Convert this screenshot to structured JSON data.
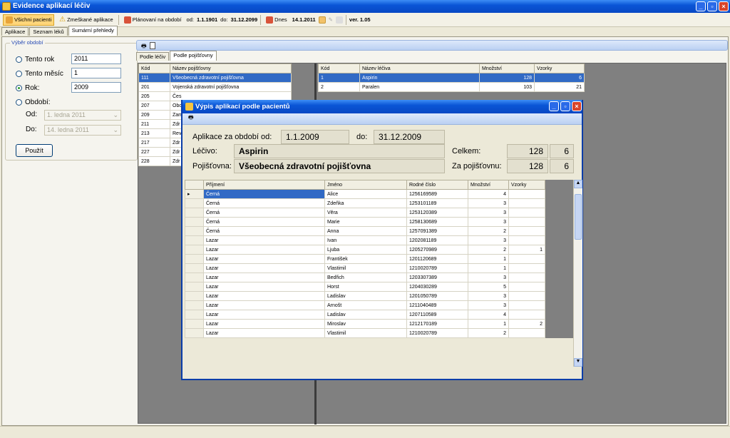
{
  "window": {
    "title": "Evidence aplikací léčiv"
  },
  "toolbar": {
    "btn_all": "Všichni pacienti",
    "btn_missed": "Zmeškané aplikace",
    "btn_plan": "Plánovaní na období",
    "from_label": "od:",
    "from_val": "1.1.1901",
    "to_label": "do:",
    "to_val": "31.12.2099",
    "today_label": "Dnes",
    "today_val": "14.1.2011",
    "version": "ver. 1.05"
  },
  "tabs": [
    "Aplikace",
    "Seznam léků",
    "Sumární přehledy"
  ],
  "period": {
    "title": "Výběr období",
    "r1": "Tento rok",
    "v1": "2011",
    "r2": "Tento měsíc",
    "v2": "1",
    "r3": "Rok:",
    "v3": "2009",
    "r4": "Období:",
    "od": "Od:",
    "od_v": "1.  ledna  2011",
    "do": "Do:",
    "do_v": "14.  ledna  2011",
    "apply": "Použít"
  },
  "subtabs": [
    "Podle léčiv",
    "Podle pojišťovny"
  ],
  "ins": {
    "h": [
      "Kód",
      "Název pojišťovny"
    ],
    "rows": [
      [
        "111",
        "Všeobecná zdravotní pojišťovna"
      ],
      [
        "201",
        "Vojenská zdravotní pojišťovna"
      ],
      [
        "205",
        "Čes"
      ],
      [
        "207",
        "Obo"
      ],
      [
        "209",
        "Zam"
      ],
      [
        "211",
        "Zdr"
      ],
      [
        "213",
        "Rev"
      ],
      [
        "217",
        "Zdr"
      ],
      [
        "227",
        "Zdr"
      ],
      [
        "228",
        "Zdr"
      ]
    ]
  },
  "drug": {
    "h": [
      "Kód",
      "Název léčiva",
      "Množství",
      "Vzorky"
    ],
    "rows": [
      [
        "1",
        "Aspirin",
        "128",
        "6"
      ],
      [
        "2",
        "Paralen",
        "103",
        "21"
      ]
    ]
  },
  "dialog": {
    "title": "Výpis aplikací podle pacientů",
    "from_label": "Aplikace za období od:",
    "from": "1.1.2009",
    "to_label": "do:",
    "to": "31.12.2009",
    "drug_label": "Léčivo:",
    "drug": "Aspirin",
    "ins_label": "Pojišťovna:",
    "ins": "Všeobecná zdravotní pojišťovna",
    "total_label": "Celkem:",
    "total": "128",
    "total_s": "6",
    "paid_label": "Za pojišťovnu:",
    "paid": "128",
    "paid_s": "6",
    "h": [
      "Příjmení",
      "Jméno",
      "Rodné číslo",
      "Množství",
      "Vzorky"
    ],
    "rows": [
      [
        "Černá",
        "Alice",
        "1256169589",
        "4",
        ""
      ],
      [
        "Černá",
        "Zdeňka",
        "1253101189",
        "3",
        ""
      ],
      [
        "Černá",
        "Věra",
        "1253120389",
        "3",
        ""
      ],
      [
        "Černá",
        "Marie",
        "1258130689",
        "3",
        ""
      ],
      [
        "Černá",
        "Anna",
        "1257091389",
        "2",
        ""
      ],
      [
        "Lazar",
        "Ivan",
        "1202081189",
        "3",
        ""
      ],
      [
        "Lazar",
        "Ljuba",
        "1205270989",
        "2",
        "1"
      ],
      [
        "Lazar",
        "František",
        "1201120689",
        "1",
        ""
      ],
      [
        "Lazar",
        "Vlastimil",
        "1210020789",
        "1",
        ""
      ],
      [
        "Lazar",
        "Bedřich",
        "1203307389",
        "3",
        ""
      ],
      [
        "Lazar",
        "Horst",
        "1204030289",
        "5",
        ""
      ],
      [
        "Lazar",
        "Ladislav",
        "1201050789",
        "3",
        ""
      ],
      [
        "Lazar",
        "Arnošt",
        "1211040489",
        "3",
        ""
      ],
      [
        "Lazar",
        "Ladislav",
        "1207110589",
        "4",
        ""
      ],
      [
        "Lazar",
        "Miroslav",
        "1212170189",
        "1",
        "2"
      ],
      [
        "Lazar",
        "Vlastimil",
        "1210020789",
        "2",
        ""
      ]
    ]
  }
}
